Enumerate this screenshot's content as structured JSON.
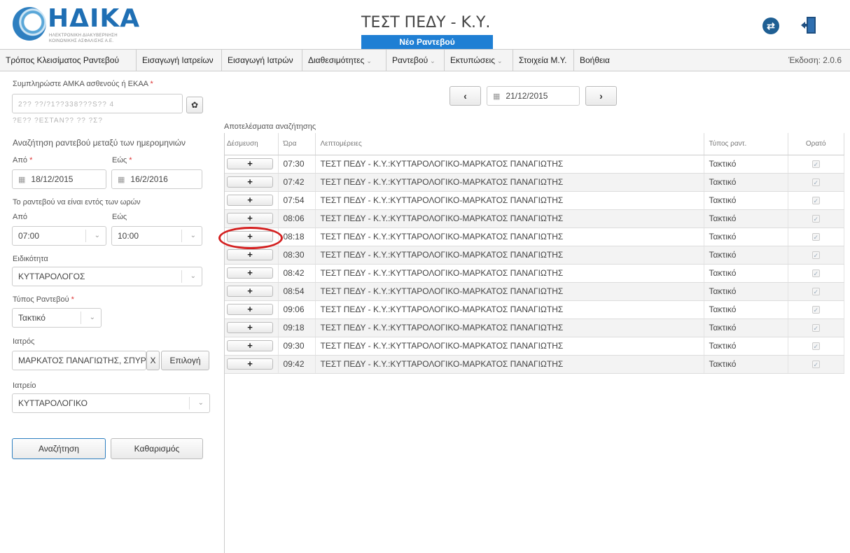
{
  "header": {
    "brand": "ΗΔΙΚΑ",
    "brand_sub1": "ΗΛΕΚΤΡΟΝΙΚΗ ΔΙΑΚΥΒΕΡΝΗΣΗ",
    "brand_sub2": "ΚΟΙΝΩΝΙΚΗΣ ΑΣΦΑΛΙΣΗΣ Α.Ε.",
    "app_title": "ΤΕΣΤ ΠΕΔΥ - Κ.Υ.",
    "page_subtitle": "Νέο Ραντεβού",
    "swap_icon": "swap-icon",
    "logout_icon": "logout-door-icon"
  },
  "menu": {
    "items": [
      {
        "label": "Τρόπος Κλεισίματος Ραντεβού"
      },
      {
        "label": "Εισαγωγή Ιατρείων"
      },
      {
        "label": "Εισαγωγή Ιατρών"
      },
      {
        "label": "Διαθεσιμότητες"
      },
      {
        "label": "Ραντεβού"
      },
      {
        "label": "Εκτυπώσεις"
      },
      {
        "label": "Στοιχεία Μ.Υ."
      },
      {
        "label": "Βοήθεια"
      }
    ],
    "version": "Έκδοση: 2.0.6"
  },
  "form": {
    "amka_label": "Συμπληρώστε ΑΜΚΑ ασθενούς ή ΕΚΑΑ",
    "amka_value": "2?? ??/?1??338???S?? 4",
    "patient_name": "?Ε?? ?ΕΣΤΑΝ?? ?? ?Σ?",
    "date_range_title": "Αναζήτηση ραντεβού μεταξύ των ημερομηνιών",
    "from_label": "Από",
    "to_label": "Εώς",
    "from_date": "18/12/2015",
    "to_date": "16/2/2016",
    "hours_title": "Το ραντεβού να είναι εντός των ωρών",
    "hour_from_label": "Από",
    "hour_to_label": "Εώς",
    "hour_from": "07:00",
    "hour_to": "10:00",
    "specialty_label": "Ειδικότητα",
    "specialty": "ΚΥΤΤΑΡΟΛΟΓΟΣ",
    "appt_type_label": "Τύπος Ραντεβού",
    "appt_type": "Τακτικό",
    "doctor_label": "Ιατρός",
    "doctor": "ΜΑΡΚΑΤΟΣ ΠΑΝΑΓΙΩΤΗΣ, ΣΠΥΡΙΔ",
    "clear_x": "X",
    "select_button": "Επιλογή",
    "office_label": "Ιατρείο",
    "office": "ΚΥΤΤΑΡΟΛΟΓΙΚΟ",
    "search_button": "Αναζήτηση",
    "clear_button": "Καθαρισμός"
  },
  "date_nav": {
    "prev": "‹",
    "next": "›",
    "date": "21/12/2015"
  },
  "results": {
    "caption": "Αποτελέσματα αναζήτησης",
    "headers": [
      "Δέσμευση",
      "Ώρα",
      "Λεπτομέρειες",
      "Τύπος ραντ.",
      "Ορατό"
    ],
    "book_symbol": "+",
    "check_symbol": "✓",
    "rows": [
      {
        "time": "07:30",
        "details": "ΤΕΣΤ ΠΕΔΥ - Κ.Υ.:ΚΥΤΤΑΡΟΛΟΓΙΚΟ-ΜΑΡΚΑΤΟΣ ΠΑΝΑΓΙΩΤΗΣ",
        "type": "Τακτικό"
      },
      {
        "time": "07:42",
        "details": "ΤΕΣΤ ΠΕΔΥ - Κ.Υ.:ΚΥΤΤΑΡΟΛΟΓΙΚΟ-ΜΑΡΚΑΤΟΣ ΠΑΝΑΓΙΩΤΗΣ",
        "type": "Τακτικό"
      },
      {
        "time": "07:54",
        "details": "ΤΕΣΤ ΠΕΔΥ - Κ.Υ.:ΚΥΤΤΑΡΟΛΟΓΙΚΟ-ΜΑΡΚΑΤΟΣ ΠΑΝΑΓΙΩΤΗΣ",
        "type": "Τακτικό"
      },
      {
        "time": "08:06",
        "details": "ΤΕΣΤ ΠΕΔΥ - Κ.Υ.:ΚΥΤΤΑΡΟΛΟΓΙΚΟ-ΜΑΡΚΑΤΟΣ ΠΑΝΑΓΙΩΤΗΣ",
        "type": "Τακτικό"
      },
      {
        "time": "08:18",
        "details": "ΤΕΣΤ ΠΕΔΥ - Κ.Υ.:ΚΥΤΤΑΡΟΛΟΓΙΚΟ-ΜΑΡΚΑΤΟΣ ΠΑΝΑΓΙΩΤΗΣ",
        "type": "Τακτικό"
      },
      {
        "time": "08:30",
        "details": "ΤΕΣΤ ΠΕΔΥ - Κ.Υ.:ΚΥΤΤΑΡΟΛΟΓΙΚΟ-ΜΑΡΚΑΤΟΣ ΠΑΝΑΓΙΩΤΗΣ",
        "type": "Τακτικό"
      },
      {
        "time": "08:42",
        "details": "ΤΕΣΤ ΠΕΔΥ - Κ.Υ.:ΚΥΤΤΑΡΟΛΟΓΙΚΟ-ΜΑΡΚΑΤΟΣ ΠΑΝΑΓΙΩΤΗΣ",
        "type": "Τακτικό"
      },
      {
        "time": "08:54",
        "details": "ΤΕΣΤ ΠΕΔΥ - Κ.Υ.:ΚΥΤΤΑΡΟΛΟΓΙΚΟ-ΜΑΡΚΑΤΟΣ ΠΑΝΑΓΙΩΤΗΣ",
        "type": "Τακτικό"
      },
      {
        "time": "09:06",
        "details": "ΤΕΣΤ ΠΕΔΥ - Κ.Υ.:ΚΥΤΤΑΡΟΛΟΓΙΚΟ-ΜΑΡΚΑΤΟΣ ΠΑΝΑΓΙΩΤΗΣ",
        "type": "Τακτικό"
      },
      {
        "time": "09:18",
        "details": "ΤΕΣΤ ΠΕΔΥ - Κ.Υ.:ΚΥΤΤΑΡΟΛΟΓΙΚΟ-ΜΑΡΚΑΤΟΣ ΠΑΝΑΓΙΩΤΗΣ",
        "type": "Τακτικό"
      },
      {
        "time": "09:30",
        "details": "ΤΕΣΤ ΠΕΔΥ - Κ.Υ.:ΚΥΤΤΑΡΟΛΟΓΙΚΟ-ΜΑΡΚΑΤΟΣ ΠΑΝΑΓΙΩΤΗΣ",
        "type": "Τακτικό"
      },
      {
        "time": "09:42",
        "details": "ΤΕΣΤ ΠΕΔΥ - Κ.Υ.:ΚΥΤΤΑΡΟΛΟΓΙΚΟ-ΜΑΡΚΑΤΟΣ ΠΑΝΑΓΙΩΤΗΣ",
        "type": "Τακτικό"
      }
    ]
  },
  "colors": {
    "brand_blue": "#1f6fb4",
    "subtitle_bg": "#1f7fd4",
    "highlight_red": "#d42020"
  }
}
